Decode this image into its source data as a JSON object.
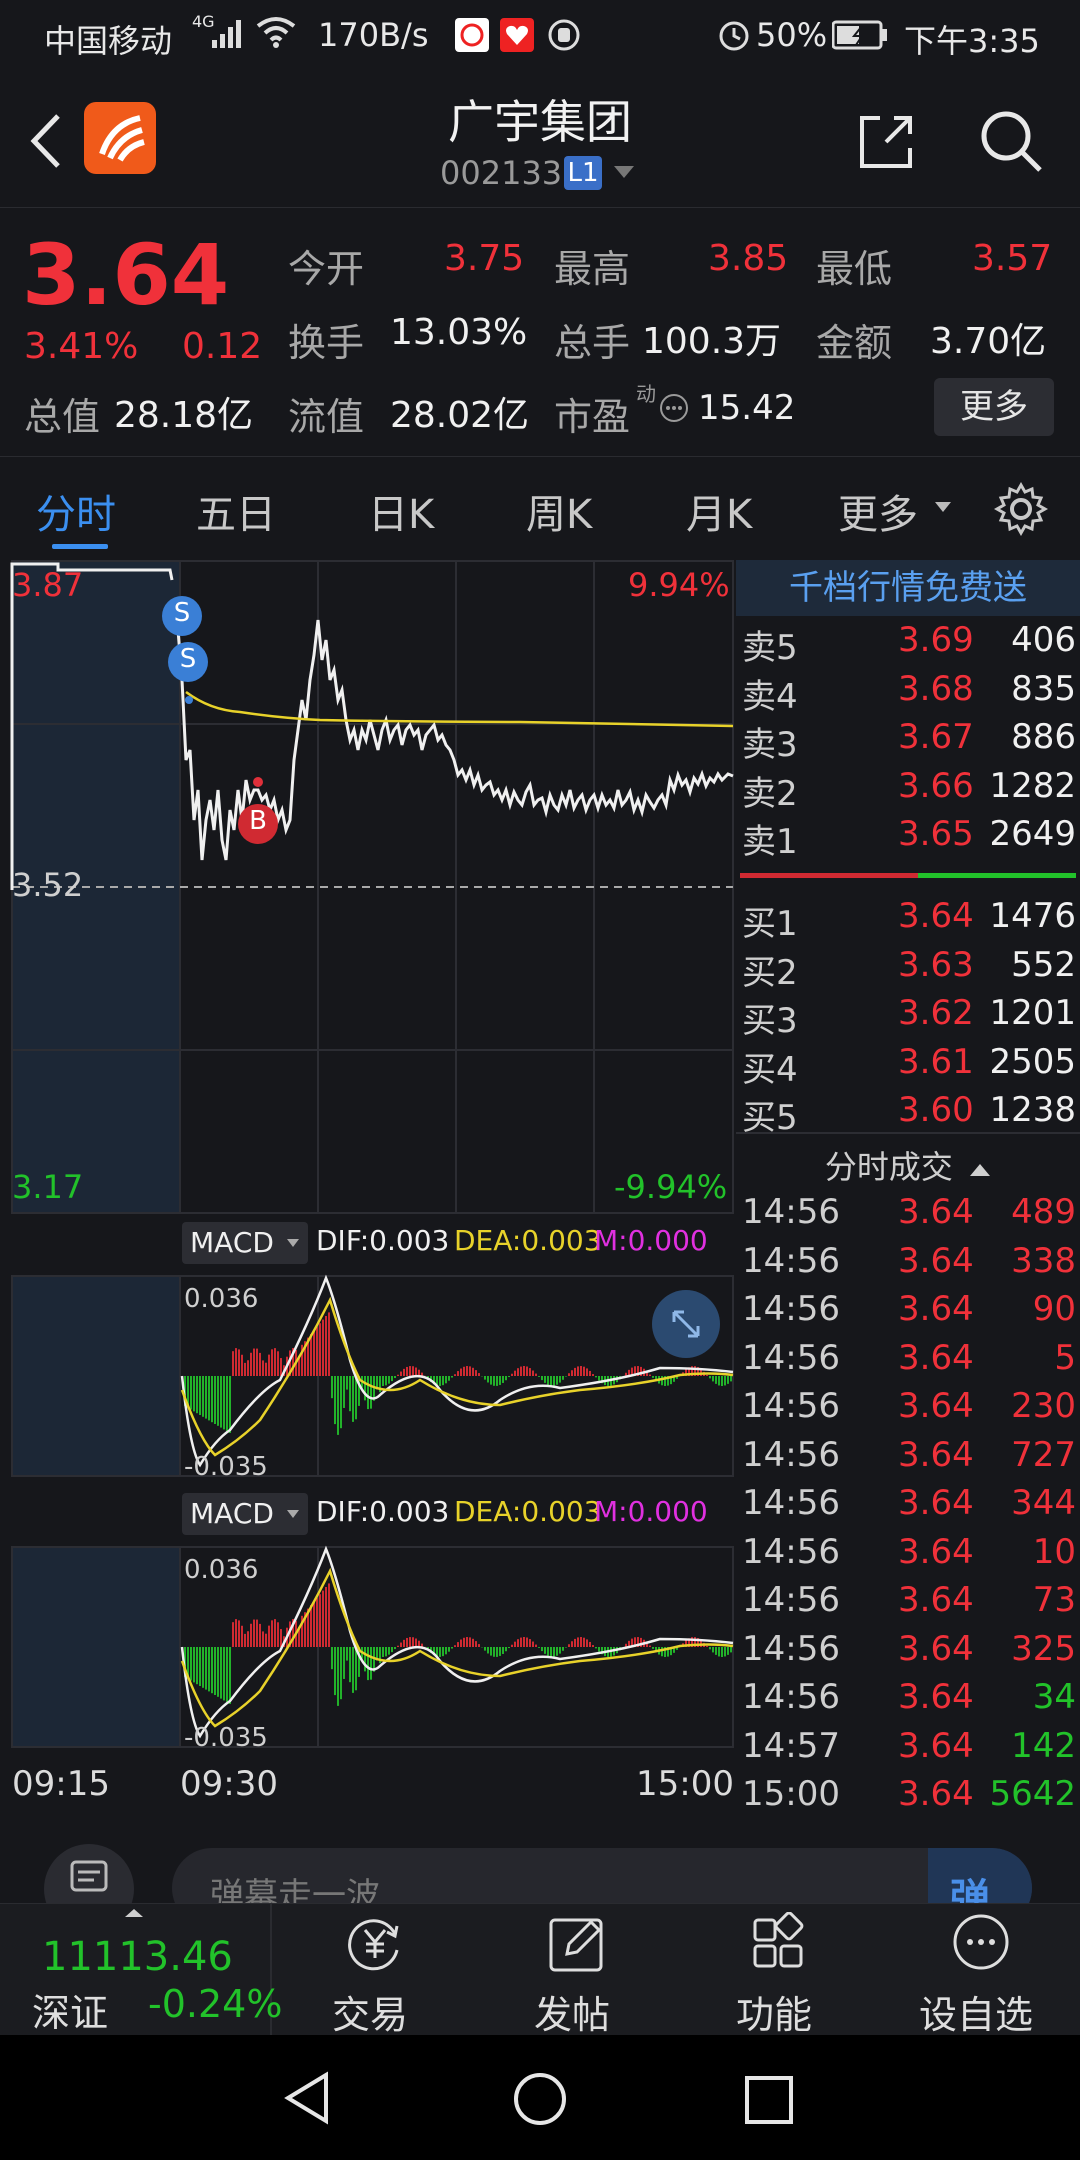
{
  "status_bar": {
    "carrier": "中国移动",
    "net_type": "4G",
    "speed": "170B/s",
    "battery": "50%",
    "time": "下午3:35"
  },
  "header": {
    "stock_name": "广宇集团",
    "stock_code": "002133",
    "level_badge": "L1"
  },
  "quote": {
    "price": "3.64",
    "change_pct": "3.41%",
    "change_amt": "0.12",
    "open_label": "今开",
    "open": "3.75",
    "high_label": "最高",
    "high": "3.85",
    "low_label": "最低",
    "low": "3.57",
    "turnover_label": "换手",
    "turnover": "13.03%",
    "volume_label": "总手",
    "volume": "100.3万",
    "amount_label": "金额",
    "amount": "3.70亿",
    "total_value_label": "总值",
    "total_value": "28.18亿",
    "float_value_label": "流值",
    "float_value": "28.02亿",
    "pe_label": "市盈",
    "pe_super": "动",
    "pe": "15.42",
    "more_button": "更多"
  },
  "tabs": [
    {
      "label": "分时"
    },
    {
      "label": "五日"
    },
    {
      "label": "日K"
    },
    {
      "label": "周K"
    },
    {
      "label": "月K"
    },
    {
      "label": "更多"
    }
  ],
  "chart": {
    "price_top": "3.87",
    "pct_top": "9.94%",
    "price_mid": "3.52",
    "price_bottom": "3.17",
    "pct_bottom": "-9.94%",
    "marker_s": "S",
    "marker_b": "B",
    "macd": {
      "name": "MACD",
      "dif": "DIF:0.003",
      "dea": "DEA:0.003",
      "m": "M:0.000",
      "top": "0.036",
      "bottom": "-0.035"
    },
    "time_labels": {
      "t1": "09:15",
      "t2": "09:30",
      "t3": "15:00"
    }
  },
  "order_book": {
    "banner": "千档行情免费送",
    "asks": [
      {
        "label": "卖5",
        "price": "3.69",
        "vol": "406"
      },
      {
        "label": "卖4",
        "price": "3.68",
        "vol": "835"
      },
      {
        "label": "卖3",
        "price": "3.67",
        "vol": "886"
      },
      {
        "label": "卖2",
        "price": "3.66",
        "vol": "1282"
      },
      {
        "label": "卖1",
        "price": "3.65",
        "vol": "2649"
      }
    ],
    "bids": [
      {
        "label": "买1",
        "price": "3.64",
        "vol": "1476"
      },
      {
        "label": "买2",
        "price": "3.63",
        "vol": "552"
      },
      {
        "label": "买3",
        "price": "3.62",
        "vol": "1201"
      },
      {
        "label": "买4",
        "price": "3.61",
        "vol": "2505"
      },
      {
        "label": "买5",
        "price": "3.60",
        "vol": "1238"
      }
    ]
  },
  "ticks": {
    "title": "分时成交",
    "rows": [
      {
        "time": "14:56",
        "price": "3.64",
        "vol": "489",
        "color": "#f0313a"
      },
      {
        "time": "14:56",
        "price": "3.64",
        "vol": "338",
        "color": "#f0313a"
      },
      {
        "time": "14:56",
        "price": "3.64",
        "vol": "90",
        "color": "#f0313a"
      },
      {
        "time": "14:56",
        "price": "3.64",
        "vol": "5",
        "color": "#f0313a"
      },
      {
        "time": "14:56",
        "price": "3.64",
        "vol": "230",
        "color": "#f0313a"
      },
      {
        "time": "14:56",
        "price": "3.64",
        "vol": "727",
        "color": "#f0313a"
      },
      {
        "time": "14:56",
        "price": "3.64",
        "vol": "344",
        "color": "#f0313a"
      },
      {
        "time": "14:56",
        "price": "3.64",
        "vol": "10",
        "color": "#f0313a"
      },
      {
        "time": "14:56",
        "price": "3.64",
        "vol": "73",
        "color": "#f0313a"
      },
      {
        "time": "14:56",
        "price": "3.64",
        "vol": "325",
        "color": "#f0313a"
      },
      {
        "time": "14:56",
        "price": "3.64",
        "vol": "34",
        "color": "#22c22a"
      },
      {
        "time": "14:57",
        "price": "3.64",
        "vol": "142",
        "color": "#22c22a"
      },
      {
        "time": "15:00",
        "price": "3.64",
        "vol": "5642",
        "color": "#22c22a"
      }
    ]
  },
  "danmu": {
    "placeholder": "弹幕走一波",
    "send_label": "弹"
  },
  "bottom_nav": {
    "index_value": "11113.46",
    "index_name": "深证",
    "index_change": "-0.24%",
    "items": [
      {
        "label": "交易"
      },
      {
        "label": "发帖"
      },
      {
        "label": "功能"
      },
      {
        "label": "设自选"
      }
    ]
  },
  "colors": {
    "up": "#f0313a",
    "down": "#22c22a",
    "accent": "#3b8ff0",
    "avg_line": "#e8d22a"
  }
}
